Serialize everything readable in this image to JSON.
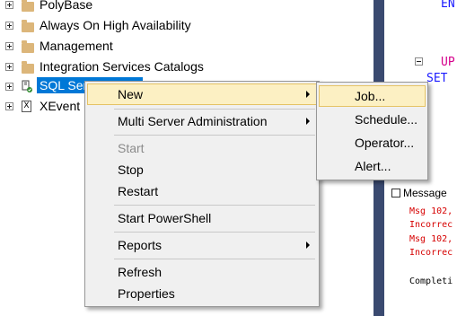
{
  "tree": {
    "items": [
      {
        "label": "PolyBase",
        "icon": "folder-icon"
      },
      {
        "label": "Always On High Availability",
        "icon": "folder-icon"
      },
      {
        "label": "Management",
        "icon": "folder-icon"
      },
      {
        "label": "Integration Services Catalogs",
        "icon": "folder-icon"
      },
      {
        "label": "SQL Server Agent",
        "icon": "sql-agent-icon",
        "selected": true
      },
      {
        "label": "XEvent Profiler",
        "icon": "xevent-icon"
      }
    ]
  },
  "editor": {
    "line1": "EN",
    "line2": "UP",
    "line3": "SET"
  },
  "results": {
    "tab_label": "Message",
    "lines": [
      "Msg 102,",
      "Incorrec",
      "Msg 102,",
      "Incorrec",
      "",
      "Completi"
    ]
  },
  "context_menu": {
    "items": {
      "new": "New",
      "multi_server": "Multi Server Administration",
      "start": "Start",
      "stop": "Stop",
      "restart": "Restart",
      "start_powershell": "Start PowerShell",
      "reports": "Reports",
      "refresh": "Refresh",
      "properties": "Properties"
    }
  },
  "new_submenu": {
    "items": {
      "job": "Job...",
      "schedule": "Schedule...",
      "operator": "Operator...",
      "alert": "Alert..."
    }
  },
  "colors": {
    "selection": "#0078d7",
    "menu_highlight": "#fcf0c3",
    "divider": "#3a4a70",
    "error_text": "#d60000"
  }
}
